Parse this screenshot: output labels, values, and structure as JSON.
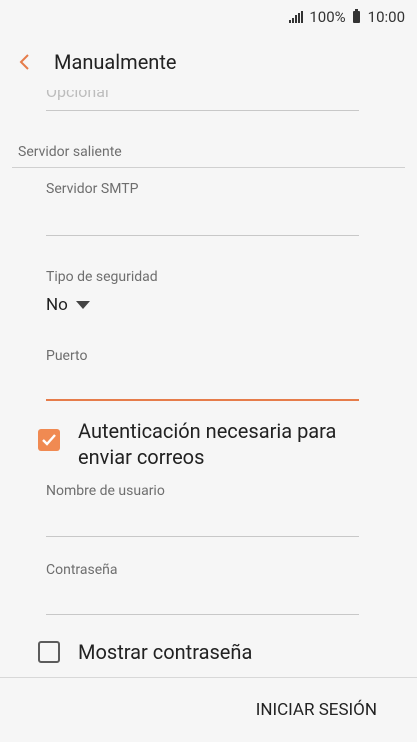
{
  "status_bar": {
    "battery": "100%",
    "time": "10:00"
  },
  "app_bar": {
    "title": "Manualmente"
  },
  "fields": {
    "prev_field_placeholder": "Opcional",
    "smtp_server_label": "Servidor SMTP",
    "security_type_label": "Tipo de seguridad",
    "security_type_value": "No",
    "port_label": "Puerto",
    "username_label": "Nombre de usuario",
    "password_label": "Contraseña"
  },
  "section": {
    "outgoing_server": "Servidor saliente"
  },
  "checkboxes": {
    "auth_required": {
      "label": "Autenticación necesaria para enviar correos",
      "checked": true
    },
    "show_password": {
      "label": "Mostrar contraseña",
      "checked": false
    }
  },
  "actions": {
    "sign_in": "INICIAR SESIÓN"
  },
  "colors": {
    "accent": "#f08a52",
    "active_line": "#e67c4a"
  }
}
